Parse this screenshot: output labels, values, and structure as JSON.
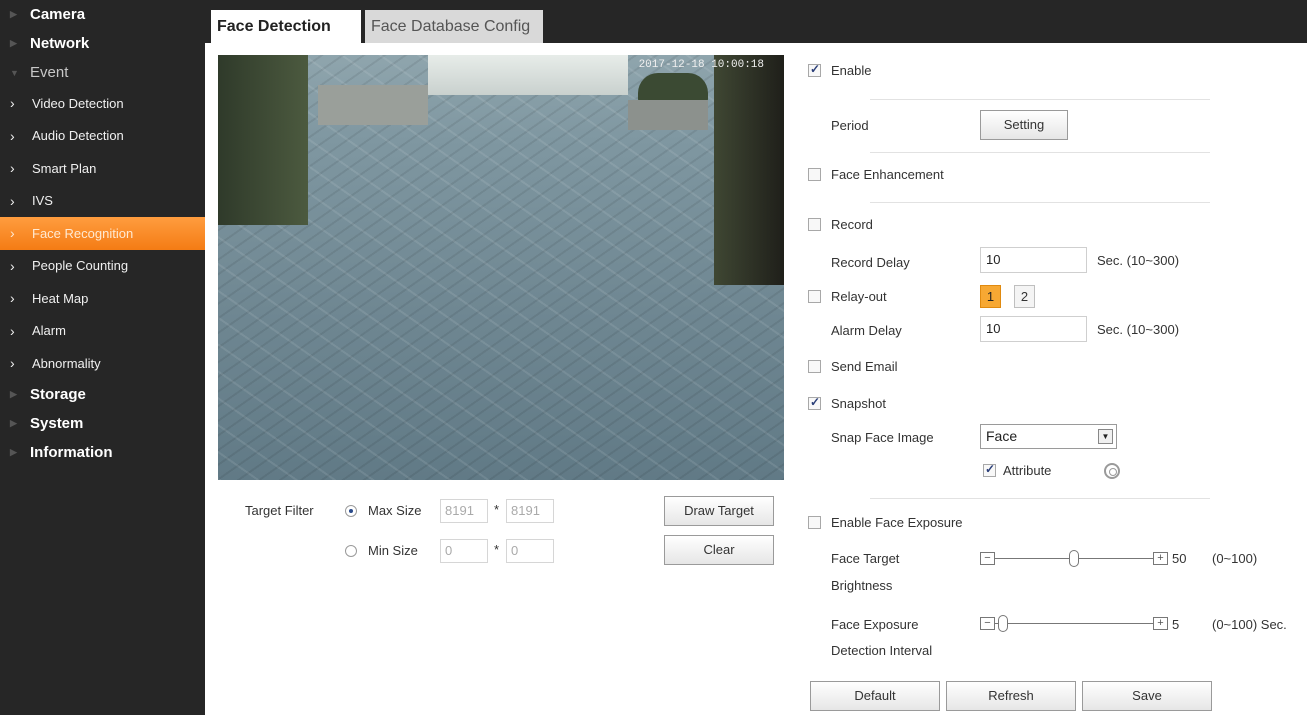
{
  "sidebar": {
    "camera": "Camera",
    "network": "Network",
    "event": "Event",
    "items": [
      {
        "label": "Video Detection"
      },
      {
        "label": "Audio Detection"
      },
      {
        "label": "Smart Plan"
      },
      {
        "label": "IVS"
      },
      {
        "label": "Face Recognition"
      },
      {
        "label": "People Counting"
      },
      {
        "label": "Heat Map"
      },
      {
        "label": "Alarm"
      },
      {
        "label": "Abnormality"
      }
    ],
    "storage": "Storage",
    "system": "System",
    "information": "Information",
    "active_color": "#f58a24"
  },
  "tabs": {
    "face_detection": "Face Detection",
    "face_database": "Face Database Config"
  },
  "video": {
    "osd_text": "2017-12-18 10:00:18"
  },
  "target_filter": {
    "label": "Target Filter",
    "max_size_label": "Max Size",
    "max_w": "8191",
    "max_h": "8191",
    "min_size_label": "Min Size",
    "min_w": "0",
    "min_h": "0",
    "star": "*",
    "draw_target": "Draw Target",
    "clear": "Clear"
  },
  "settings": {
    "enable": "Enable",
    "period": "Period",
    "setting_btn": "Setting",
    "face_enhancement": "Face Enhancement",
    "record": "Record",
    "record_delay": "Record Delay",
    "record_delay_value": "10",
    "record_delay_unit": "Sec. (10~300)",
    "relay_out": "Relay-out",
    "relay_1": "1",
    "relay_2": "2",
    "alarm_delay": "Alarm Delay",
    "alarm_delay_value": "10",
    "alarm_delay_unit": "Sec. (10~300)",
    "send_email": "Send Email",
    "snapshot": "Snapshot",
    "snap_face_image": "Snap Face Image",
    "snap_face_value": "Face",
    "attribute": "Attribute",
    "enable_face_exposure": "Enable Face Exposure",
    "face_target_brightness_1": "Face Target",
    "face_target_brightness_2": "Brightness",
    "brightness_value": "50",
    "brightness_range": "(0~100)",
    "face_exposure_1": "Face Exposure",
    "face_exposure_2": "Detection Interval",
    "interval_value": "5",
    "interval_range": "(0~100) Sec.",
    "minus": "−",
    "plus": "+"
  },
  "footer": {
    "default": "Default",
    "refresh": "Refresh",
    "save": "Save"
  }
}
